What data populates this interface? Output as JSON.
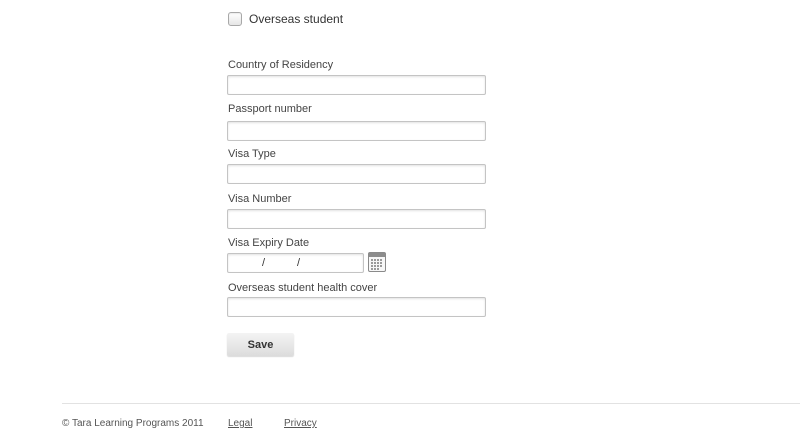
{
  "overseas": {
    "checkbox_label": "Overseas student",
    "checked": false
  },
  "fields": [
    {
      "label": "Country of Residency",
      "value": "",
      "placeholder": ""
    },
    {
      "label": "Passport number",
      "value": "",
      "placeholder": ""
    },
    {
      "label": "Visa Type",
      "value": "",
      "placeholder": ""
    },
    {
      "label": "Visa Number",
      "value": "",
      "placeholder": ""
    },
    {
      "label": "Visa Expiry Date",
      "day": "",
      "month": "",
      "year": "",
      "separator": "/",
      "calendar_icon": "calendar-icon"
    },
    {
      "label": "Overseas student health cover",
      "value": "",
      "placeholder": ""
    }
  ],
  "actions": {
    "save_label": "Save"
  },
  "footer": {
    "copyright": "© Tara Learning Programs 2011",
    "legal": "Legal",
    "privacy": "Privacy"
  }
}
